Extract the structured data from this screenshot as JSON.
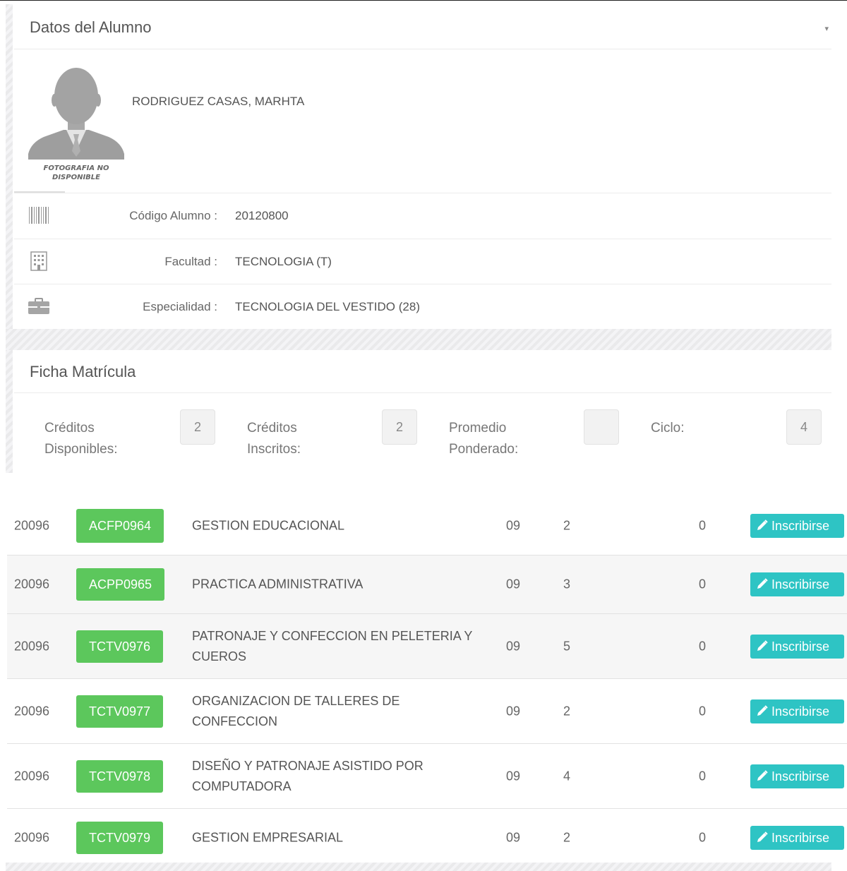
{
  "student_panel": {
    "title": "Datos del Alumno",
    "collapse_icon": "chevron-down-icon",
    "photo_caption_line1": "FOTOGRAFIA NO",
    "photo_caption_line2": "DISPONIBLE",
    "name": "RODRIGUEZ CASAS, MARHTA",
    "fields": [
      {
        "icon": "barcode-icon",
        "label": "Código Alumno :",
        "value": "20120800"
      },
      {
        "icon": "building-icon",
        "label": "Facultad :",
        "value": "TECNOLOGIA (T)"
      },
      {
        "icon": "briefcase-icon",
        "label": "Especialidad :",
        "value": "TECNOLOGIA DEL VESTIDO (28)"
      }
    ]
  },
  "enrollment_panel": {
    "title": "Ficha Matrícula",
    "stats": [
      {
        "label_line1": "Créditos",
        "label_line2": "Disponibles:",
        "value": "2"
      },
      {
        "label_line1": "Créditos",
        "label_line2": "Inscritos:",
        "value": "2"
      },
      {
        "label_line1": "Promedio",
        "label_line2": "Ponderado:",
        "value": ""
      },
      {
        "label_line1": "Ciclo:",
        "label_line2": "",
        "value": "4"
      }
    ]
  },
  "courses": {
    "button_label": "Inscribirse",
    "button_icon": "pencil-icon",
    "colors": {
      "code_badge": "#5cc75c",
      "enroll_button": "#2ec4c4"
    },
    "rows": [
      {
        "id": "20096",
        "code": "ACFP0964",
        "name": "GESTION EDUCACIONAL",
        "n1": "09",
        "n2": "2",
        "n3": "0"
      },
      {
        "id": "20096",
        "code": "ACPP0965",
        "name": "PRACTICA ADMINISTRATIVA",
        "n1": "09",
        "n2": "3",
        "n3": "0"
      },
      {
        "id": "20096",
        "code": "TCTV0976",
        "name": "PATRONAJE Y CONFECCION EN PELETERIA Y CUEROS",
        "n1": "09",
        "n2": "5",
        "n3": "0"
      },
      {
        "id": "20096",
        "code": "TCTV0977",
        "name": "ORGANIZACION DE TALLERES DE CONFECCION",
        "n1": "09",
        "n2": "2",
        "n3": "0"
      },
      {
        "id": "20096",
        "code": "TCTV0978",
        "name": "DISEÑO Y PATRONAJE ASISTIDO POR COMPUTADORA",
        "n1": "09",
        "n2": "4",
        "n3": "0"
      },
      {
        "id": "20096",
        "code": "TCTV0979",
        "name": "GESTION EMPRESARIAL",
        "n1": "09",
        "n2": "2",
        "n3": "0"
      }
    ]
  }
}
